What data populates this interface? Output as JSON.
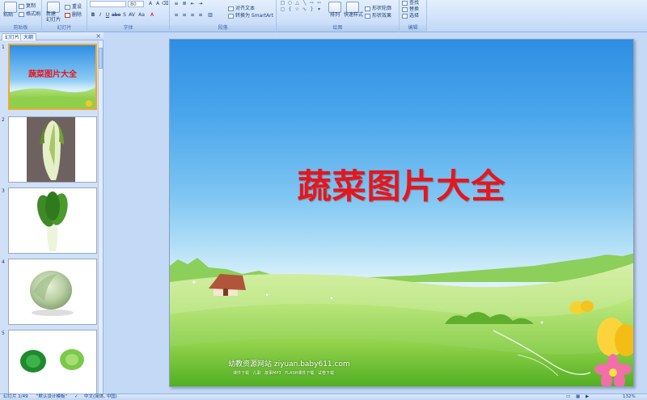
{
  "ribbon": {
    "clipboard": {
      "paste": "粘贴",
      "copy": "复制",
      "format_painter": "格式刷",
      "label": "剪贴板"
    },
    "slides": {
      "new_slide": "新建\n幻灯片",
      "reset": "重设",
      "delete": "删除",
      "label": "幻灯片"
    },
    "font": {
      "font_size": "80",
      "label": "字体"
    },
    "paragraph": {
      "align_text": "对齐文本",
      "convert_smartart": "转换为 SmartArt",
      "label": "段落"
    },
    "drawing": {
      "arrange": "排列",
      "quick_styles": "快速样式",
      "shape_outline": "形状轮廓",
      "shape_effects": "形状效果",
      "label": "绘图"
    },
    "editing": {
      "find": "查找",
      "replace": "替换",
      "select": "选择",
      "label": "编辑"
    }
  },
  "left_pane": {
    "tabs": [
      "幻灯片",
      "大纲"
    ],
    "close": "×",
    "thumbnails": [
      {
        "number": "1",
        "title": "蔬菜图片大全"
      },
      {
        "number": "2"
      },
      {
        "number": "3"
      },
      {
        "number": "4"
      },
      {
        "number": "5"
      }
    ]
  },
  "slide": {
    "title": "蔬菜图片大全",
    "footer_line1": "幼教资源网站 ziyuan.baby611.com",
    "footer_line2": "课件下载  儿歌  故事MP3  FLASH课件下载  试卷下载"
  },
  "status_bar": {
    "slide_position": "幻灯片 1/49",
    "theme": "\"默认设计模板\"",
    "language": "中文(简体, 中国)",
    "zoom": "132%"
  },
  "colors": {
    "title_red": "#e5161c",
    "ribbon_bg": "#cfe1fa",
    "selection": "#f0a830"
  }
}
